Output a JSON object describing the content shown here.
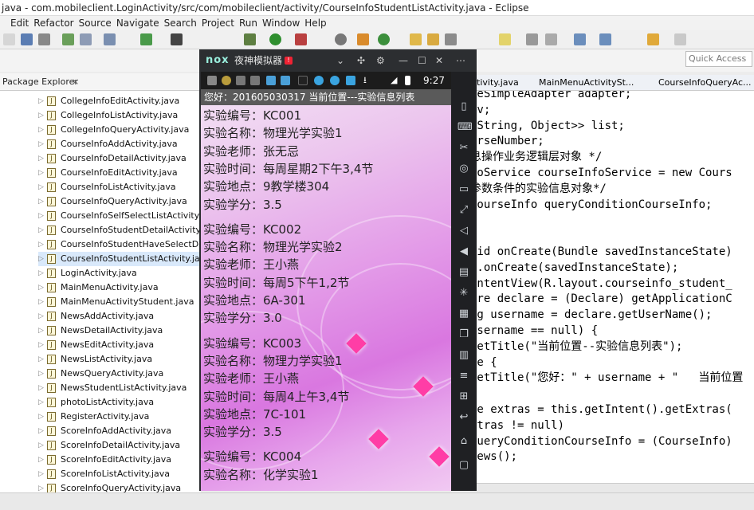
{
  "window_title": "java - com.mobileclient.LoginActivity/src/com/mobileclient/activity/CourseInfoStudentListActivity.java - Eclipse",
  "menu": [
    "Edit",
    "Refactor",
    "Source",
    "Navigate",
    "Search",
    "Project",
    "Run",
    "Window",
    "Help"
  ],
  "quick_access": "Quick Access",
  "package_explorer": {
    "title": "Package Explorer",
    "close_icon": "×",
    "files": [
      "CollegeInfoEditActivity.java",
      "CollegeInfoListActivity.java",
      "CollegeInfoQueryActivity.java",
      "CourseInfoAddActivity.java",
      "CourseInfoDetailActivity.java",
      "CourseInfoEditActivity.java",
      "CourseInfoListActivity.java",
      "CourseInfoQueryActivity.java",
      "CourseInfoSelfSelectListActivity.java",
      "CourseInfoStudentDetailActivity.java",
      "CourseInfoStudentHaveSelectDeta",
      "CourseInfoStudentListActivity.java",
      "LoginActivity.java",
      "MainMenuActivity.java",
      "MainMenuActivityStudent.java",
      "NewsAddActivity.java",
      "NewsDetailActivity.java",
      "NewsEditActivity.java",
      "NewsListActivity.java",
      "NewsQueryActivity.java",
      "NewsStudentListActivity.java",
      "photoListActivity.java",
      "RegisterActivity.java",
      "ScoreInfoAddActivity.java",
      "ScoreInfoDetailActivity.java",
      "ScoreInfoEditActivity.java",
      "ScoreInfoListActivity.java",
      "ScoreInfoQueryActivity.java"
    ],
    "selected_file": "CourseInfoStudentListActivity.java"
  },
  "editor_tabs": [
    "ctivity.java",
    "MainMenuActivitySt...",
    "CourseInfoQueryAc..."
  ],
  "code_lines": [
    "ieSimpleAdapter adapter;",
    "lv;",
    "<String, Object>> list;",
    "urseNumber;",
    "息操作业务逻辑层对象 */",
    "foService courseInfoService = new Cours",
    "参数条件的实验信息对象*/",
    "CourseInfo queryConditionCourseInfo;",
    "",
    "e",
    "oid onCreate(Bundle savedInstanceState)",
    "r.onCreate(savedInstanceState);",
    "ontentView(R.layout.courseinfo_student_",
    "are declare = (Declare) getApplicationC",
    "ng username = declare.getUserName();",
    "username == null) {",
    "setTitle(\"当前位置--实验信息列表\");",
    "se {",
    "setTitle(\"您好：\" + username + \"   当前位置",
    "",
    "le extras = this.getIntent().getExtras(",
    "xtras != null)",
    "queryConditionCourseInfo = (CourseInfo)",
    "iews();"
  ],
  "emulator": {
    "logo": "nox",
    "title": "夜神模拟器",
    "badge": "!",
    "status_time": "9:27",
    "app_title": "您好：201605030317   当前位置---实验信息列表",
    "entries": [
      {
        "code": "实验编号：KC001",
        "name": "实验名称：物理光学实验1",
        "teacher": "实验老师：张无忌",
        "time": "实验时间：每周星期2下午3,4节",
        "place": "实验地点：9教学楼304",
        "credit": "实验学分：3.5"
      },
      {
        "code": "实验编号：KC002",
        "name": "实验名称：物理光学实验2",
        "teacher": "实验老师：王小燕",
        "time": "实验时间：每周5下午1,2节",
        "place": "实验地点：6A-301",
        "credit": "实验学分：3.0"
      },
      {
        "code": "实验编号：KC003",
        "name": "实验名称：物理力学实验1",
        "teacher": "实验老师：王小燕",
        "time": "实验时间：每周4上午3,4节",
        "place": "实验地点：7C-101",
        "credit": "实验学分：3.5"
      },
      {
        "code": "实验编号：KC004",
        "name": "实验名称：化学实验1"
      }
    ]
  }
}
